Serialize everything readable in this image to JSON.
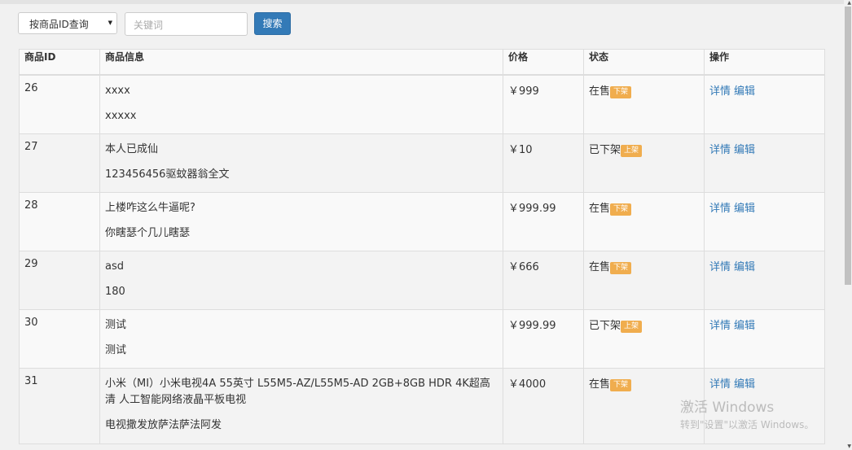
{
  "search": {
    "select_value": "按商品ID查询",
    "input_placeholder": "关键词",
    "button_label": "搜索"
  },
  "table": {
    "headers": [
      "商品ID",
      "商品信息",
      "价格",
      "状态",
      "操作"
    ],
    "rows": [
      {
        "id": "26",
        "info": [
          "xxxx",
          "xxxxx"
        ],
        "price": "￥999",
        "status": "在售",
        "action": "下架",
        "links": [
          "详情",
          "编辑"
        ]
      },
      {
        "id": "27",
        "info": [
          "本人已成仙",
          "123456456驱蚊器翁全文"
        ],
        "price": "￥10",
        "status": "已下架",
        "action": "上架",
        "links": [
          "详情",
          "编辑"
        ]
      },
      {
        "id": "28",
        "info": [
          "上楼咋这么牛逼呢?",
          "你瞎瑟个几儿瞎瑟"
        ],
        "price": "￥999.99",
        "status": "在售",
        "action": "下架",
        "links": [
          "详情",
          "编辑"
        ]
      },
      {
        "id": "29",
        "info": [
          "asd",
          "180"
        ],
        "price": "￥666",
        "status": "在售",
        "action": "下架",
        "links": [
          "详情",
          "编辑"
        ]
      },
      {
        "id": "30",
        "info": [
          "测试",
          "测试"
        ],
        "price": "￥999.99",
        "status": "已下架",
        "action": "上架",
        "links": [
          "详情",
          "编辑"
        ]
      },
      {
        "id": "31",
        "info": [
          "小米（MI）小米电视4A 55英寸 L55M5-AZ/L55M5-AD 2GB+8GB HDR 4K超高清 人工智能网络液晶平板电视",
          "电视撒发放萨法萨法阿发"
        ],
        "price": "￥4000",
        "status": "在售",
        "action": "下架",
        "links": [
          "详情",
          "编辑"
        ]
      }
    ]
  },
  "watermark": {
    "line1": "激活 Windows",
    "line2": "转到\"设置\"以激活 Windows。"
  },
  "colors": {
    "primary": "#337ab7",
    "badge": "#f0ad4e"
  }
}
